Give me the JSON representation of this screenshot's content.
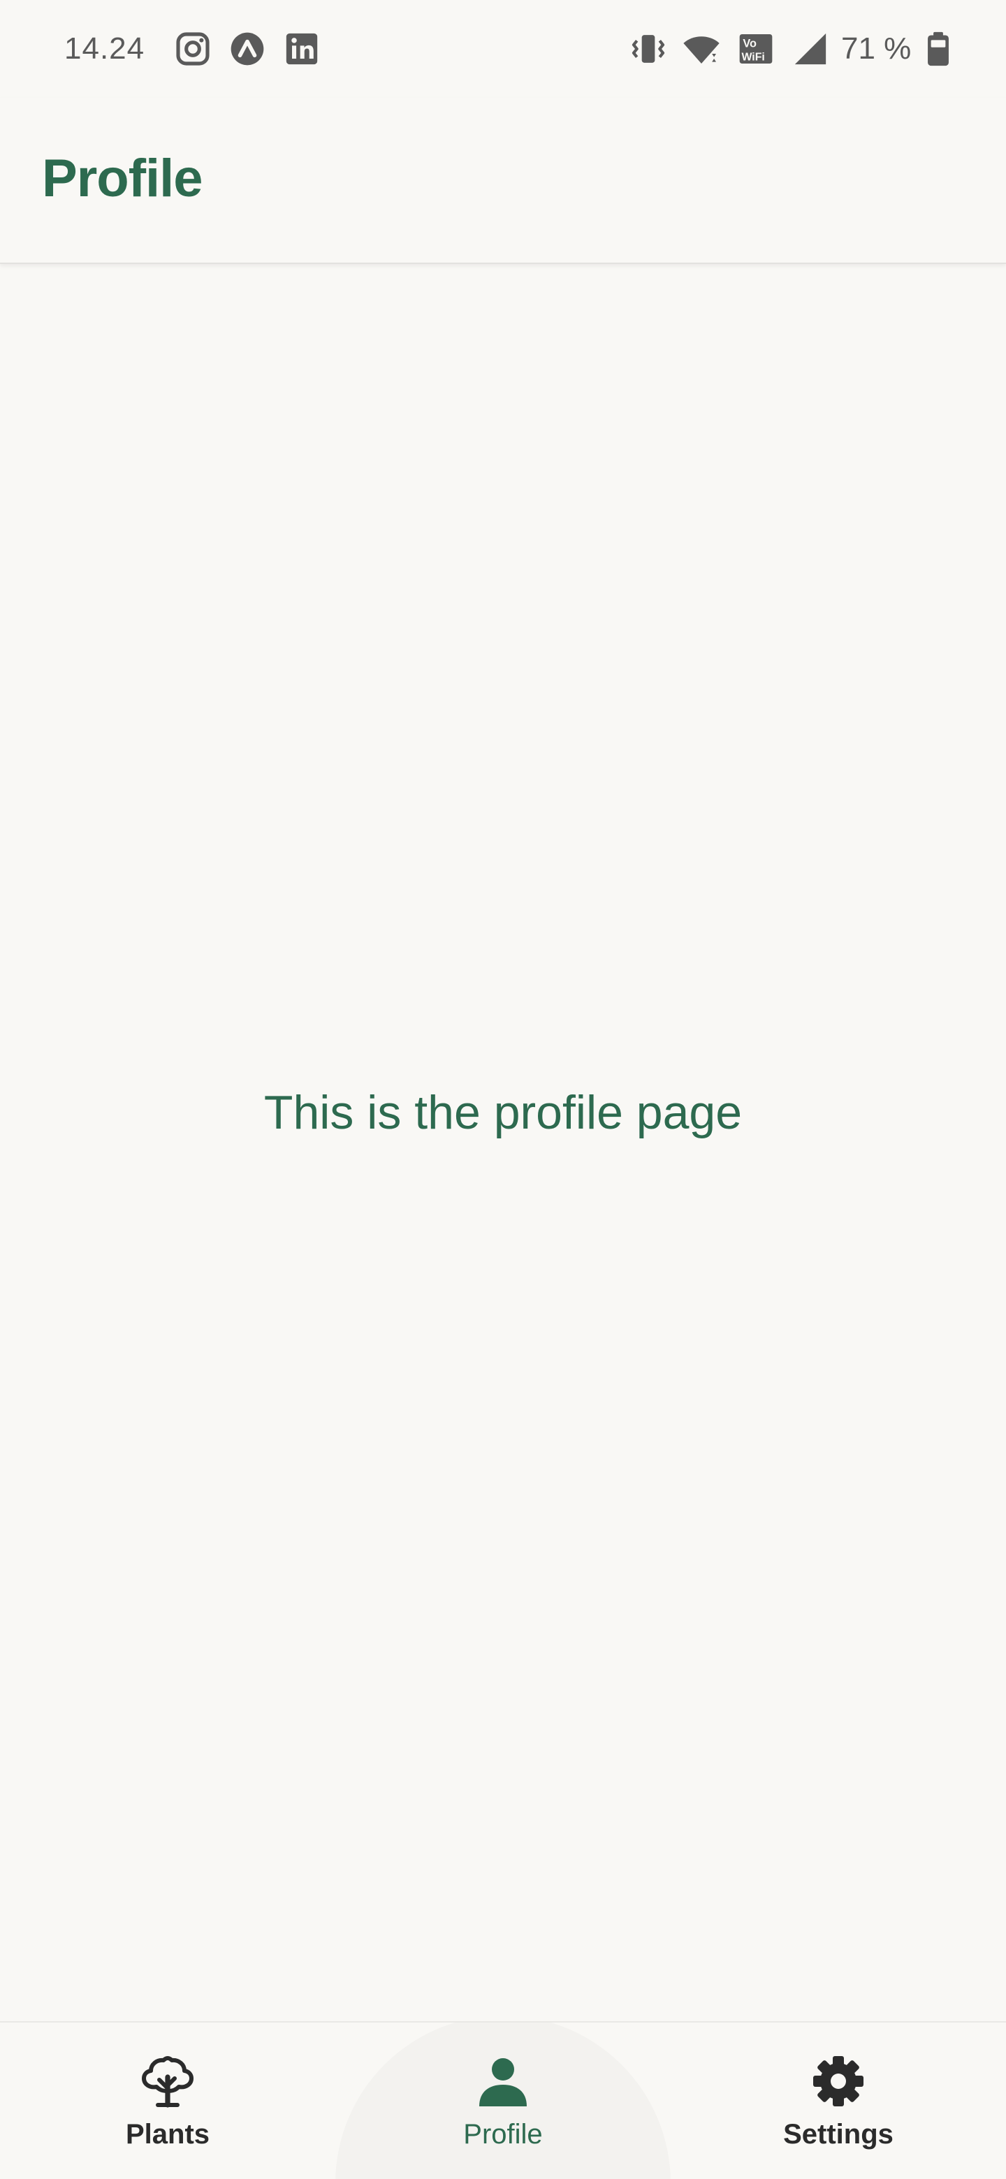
{
  "status_bar": {
    "time": "14.24",
    "battery_percent": "71 %",
    "notification_icons": [
      "instagram-icon",
      "expo-icon",
      "linkedin-icon"
    ],
    "system_icons": [
      "vibrate-icon",
      "wifi-icon",
      "vowifi-icon",
      "cell-signal-icon",
      "battery-icon"
    ]
  },
  "app_bar": {
    "title": "Profile"
  },
  "main": {
    "message": "This is the profile page"
  },
  "bottom_nav": {
    "items": [
      {
        "label": "Plants",
        "icon": "tree-icon",
        "active": false
      },
      {
        "label": "Profile",
        "icon": "person-icon",
        "active": true
      },
      {
        "label": "Settings",
        "icon": "gear-icon",
        "active": false
      }
    ]
  },
  "colors": {
    "background": "#f9f8f5",
    "accent": "#2d6a4f",
    "icon_default": "#2b2b2b",
    "status_text": "#5a5a5a"
  }
}
